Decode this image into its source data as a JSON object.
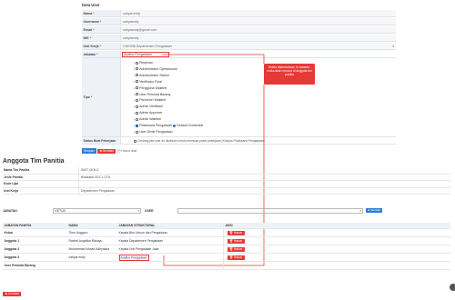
{
  "data_user": {
    "title": "Data User",
    "fields": [
      {
        "label": "Nama",
        "req": true,
        "value": "cahyai endy"
      },
      {
        "label": "Username",
        "req": true,
        "value": "cahyaendy"
      },
      {
        "label": "Email",
        "req": true,
        "value": "cahyaendy@gmail.com"
      },
      {
        "label": "NIK",
        "req": true,
        "value": "cahyaendy"
      },
      {
        "label": "Unit Kerja",
        "req": true,
        "value": "CHK008-Departemen Pengadaan"
      }
    ],
    "jabatan_label": "Jabatan",
    "jabatan_value": "Auditor Pengadaan",
    "tipe_label": "Tipe",
    "tipe_options": [
      {
        "label": "Pimpinan",
        "checked": false
      },
      {
        "label": "Administrator Operasional",
        "checked": false
      },
      {
        "label": "Administrator Sistem",
        "checked": false
      },
      {
        "label": "Verifikator Final",
        "checked": false
      },
      {
        "label": "Pengguna Wakitrel",
        "checked": false
      },
      {
        "label": "User Peminta Barang",
        "checked": false
      },
      {
        "label": "Pemohon Wakitrel",
        "checked": false
      },
      {
        "label": "Admin Verifikasi",
        "checked": false
      },
      {
        "label": "Admin Approver",
        "checked": false
      },
      {
        "label": "Admin Wakitrel",
        "checked": false
      },
      {
        "label": "Pelaksana Pengadaan",
        "checked": true,
        "extra": "Default Credential"
      },
      {
        "label": "User Divisi Pengadaan",
        "checked": false
      }
    ],
    "status_label": "Status Buat Pekerjaan",
    "status_text": "Centang jika user ini diizinkan untuk membuat paket pekerjaan (Khusus Pelaksana Pengadaan)",
    "simpan": "Simpan",
    "kembali": "Kembali",
    "required_note": "(*) Harus diisi"
  },
  "annotation": {
    "text": "Ketika ditambahkan di Jabatan, maka akan muncul di anggota tim panitia",
    "color": "#e53935"
  },
  "anggota": {
    "title": "Anggota Tim Panitia",
    "info": [
      {
        "label": "Nama Tim Panitia",
        "value": "SMIT UKM-2"
      },
      {
        "label": "Jenis Panitia",
        "value": "Bidakalisi SDC LOTA"
      },
      {
        "label": "Kode Ujat",
        "value": ""
      },
      {
        "label": "Unit Kerja",
        "value": "Departemen Pengadaan"
      }
    ],
    "jabatan_label": "JABATAN",
    "jabatan_value": "KETUA",
    "user_label": "USER",
    "tambah": "Tambah",
    "headers": [
      "JABATAN PANITIA",
      "NAMA",
      "JABATAN STRUKTURAL",
      "AKSI"
    ],
    "rows": [
      {
        "jabatan": "Ketua",
        "nama": "Timo Anggoro",
        "struktural": "Kepala Biro Umum dan Pengadaan",
        "aksi": "Hapus"
      },
      {
        "jabatan": "Anggota 1",
        "nama": "Rachel Angelika Rahayu",
        "struktural": "Kepala Departemen Pengadaan",
        "aksi": "Hapus"
      },
      {
        "jabatan": "Anggota 2",
        "nama": "Muhammad Ikhsan Adhyaksa",
        "struktural": "Kepala Unit Pengadaan Jasa",
        "aksi": "Hapus"
      },
      {
        "jabatan": "Anggota 3",
        "nama": "cahyai endy",
        "struktural": "Auditor Pengadaan",
        "aksi": "Hapus"
      },
      {
        "jabatan": "User Peminta Barang",
        "nama": "",
        "struktural": "",
        "aksi": ""
      }
    ],
    "kembali": "Kembali"
  }
}
